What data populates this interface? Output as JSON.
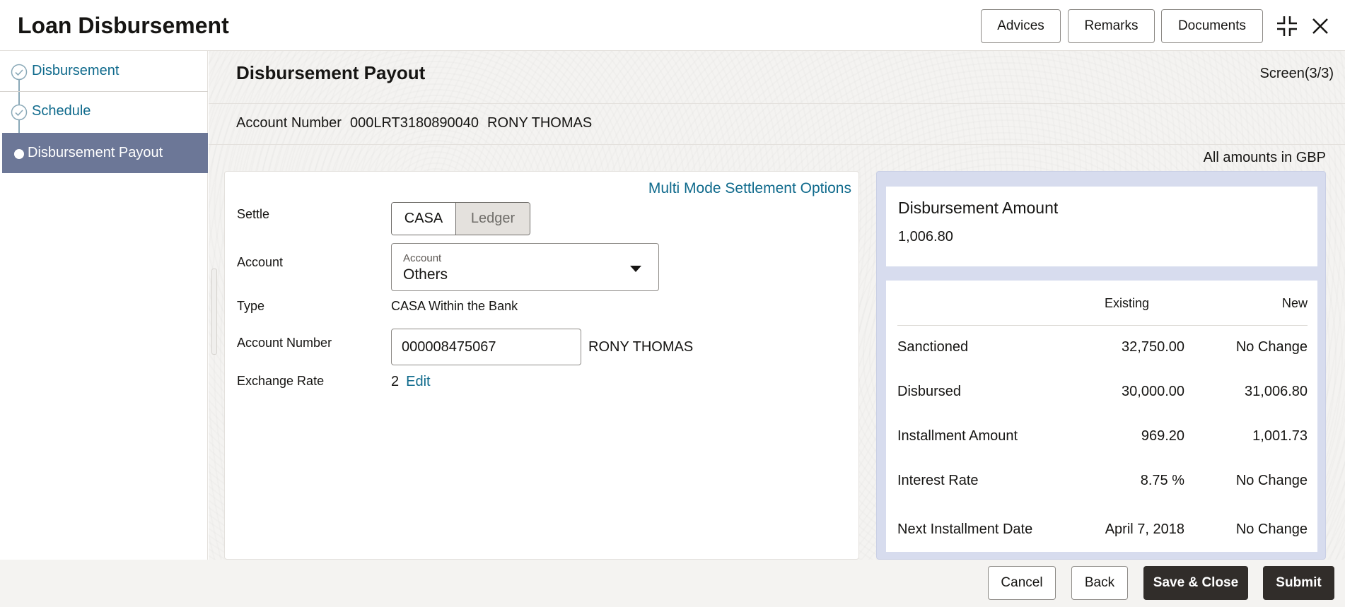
{
  "header": {
    "title": "Loan Disbursement",
    "buttons": {
      "advices": "Advices",
      "remarks": "Remarks",
      "documents": "Documents"
    }
  },
  "sidebar": {
    "steps": [
      {
        "label": "Disbursement",
        "state": "completed"
      },
      {
        "label": "Schedule",
        "state": "completed"
      },
      {
        "label": "Disbursement Payout",
        "state": "active"
      }
    ]
  },
  "main": {
    "title": "Disbursement Payout",
    "screen_indicator": "Screen(3/3)",
    "account_line": {
      "label": "Account Number",
      "number": "000LRT3180890040",
      "name": "RONY THOMAS"
    },
    "amounts_note": "All amounts in GBP"
  },
  "form": {
    "multi_mode_link": "Multi Mode Settlement Options",
    "settle": {
      "label": "Settle",
      "options": [
        "CASA",
        "Ledger"
      ],
      "selected": "CASA"
    },
    "account": {
      "label": "Account",
      "select_label": "Account",
      "value": "Others"
    },
    "type": {
      "label": "Type",
      "value": "CASA Within the Bank"
    },
    "account_number": {
      "label": "Account Number",
      "value": "000008475067",
      "name": "RONY THOMAS"
    },
    "exchange_rate": {
      "label": "Exchange Rate",
      "value": "2",
      "edit": "Edit"
    }
  },
  "summary": {
    "amount_title": "Disbursement Amount",
    "amount_value": "1,006.80",
    "columns": {
      "existing": "Existing",
      "new": "New"
    },
    "rows": [
      {
        "label": "Sanctioned",
        "existing": "32,750.00",
        "new": "No Change"
      },
      {
        "label": "Disbursed",
        "existing": "30,000.00",
        "new": "31,006.80"
      },
      {
        "label": "Installment Amount",
        "existing": "969.20",
        "new": "1,001.73"
      },
      {
        "label": "Interest Rate",
        "existing": "8.75 %",
        "new": "No Change"
      },
      {
        "label": "Next Installment Date",
        "existing": "April 7, 2018",
        "new": "No Change"
      }
    ]
  },
  "footer": {
    "cancel": "Cancel",
    "back": "Back",
    "save_close": "Save & Close",
    "submit": "Submit"
  },
  "colors": {
    "accent_link": "#0f6a8c",
    "active_step_bg": "#6c7797",
    "summary_panel_bg": "#d7dcee",
    "primary_button_bg": "#312d2a"
  }
}
